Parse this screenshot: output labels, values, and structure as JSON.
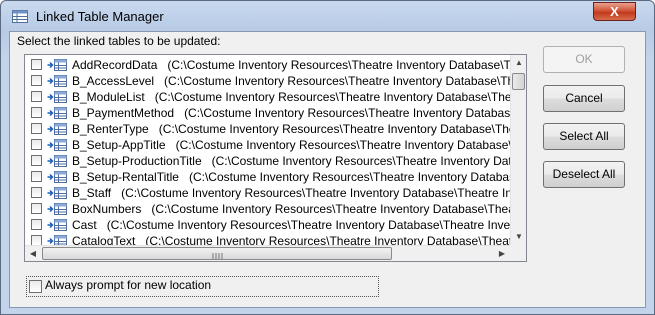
{
  "window": {
    "title": "Linked Table Manager",
    "close_glyph": "X",
    "icon": "table-app-icon"
  },
  "prompt": "Select the linked tables to be updated:",
  "tables": [
    {
      "name": "AddRecordData",
      "path": "(C:\\Costume Inventory Resources\\Theatre Inventory Database\\Theatre In"
    },
    {
      "name": "B_AccessLevel",
      "path": "(C:\\Costume Inventory Resources\\Theatre Inventory Database\\Theatre In"
    },
    {
      "name": "B_ModuleList",
      "path": "(C:\\Costume Inventory Resources\\Theatre Inventory Database\\Theatre In"
    },
    {
      "name": "B_PaymentMethod",
      "path": "(C:\\Costume Inventory Resources\\Theatre Inventory Database\\Theatre"
    },
    {
      "name": "B_RenterType",
      "path": "(C:\\Costume Inventory Resources\\Theatre Inventory Database\\Theatre In"
    },
    {
      "name": "B_Setup-AppTitle",
      "path": "(C:\\Costume Inventory Resources\\Theatre Inventory Database\\Theatre"
    },
    {
      "name": "B_Setup-ProductionTitle",
      "path": "(C:\\Costume Inventory Resources\\Theatre Inventory Database\\Th"
    },
    {
      "name": "B_Setup-RentalTitle",
      "path": "(C:\\Costume Inventory Resources\\Theatre Inventory Database\\Theat"
    },
    {
      "name": "B_Staff",
      "path": "(C:\\Costume Inventory Resources\\Theatre Inventory Database\\Theatre Inve"
    },
    {
      "name": "BoxNumbers",
      "path": "(C:\\Costume Inventory Resources\\Theatre Inventory Database\\Theatre Inve"
    },
    {
      "name": "Cast",
      "path": "(C:\\Costume Inventory Resources\\Theatre Inventory Database\\Theatre Inve"
    },
    {
      "name": "CatalogText",
      "path": "(C:\\Costume Inventory Resources\\Theatre Inventory Database\\Theatre Inve"
    }
  ],
  "buttons": {
    "ok": "OK",
    "cancel": "Cancel",
    "select_all": "Select All",
    "deselect_all": "Deselect All"
  },
  "always_prompt": {
    "label": "Always prompt for new location",
    "checked": false
  },
  "scroll": {
    "vertical_position": 0.0,
    "horizontal_position": 0.0
  },
  "colors": {
    "title_bar": "#c3d4ea",
    "close": "#c13a1c",
    "dialog_bg": "#f0f0f0"
  }
}
